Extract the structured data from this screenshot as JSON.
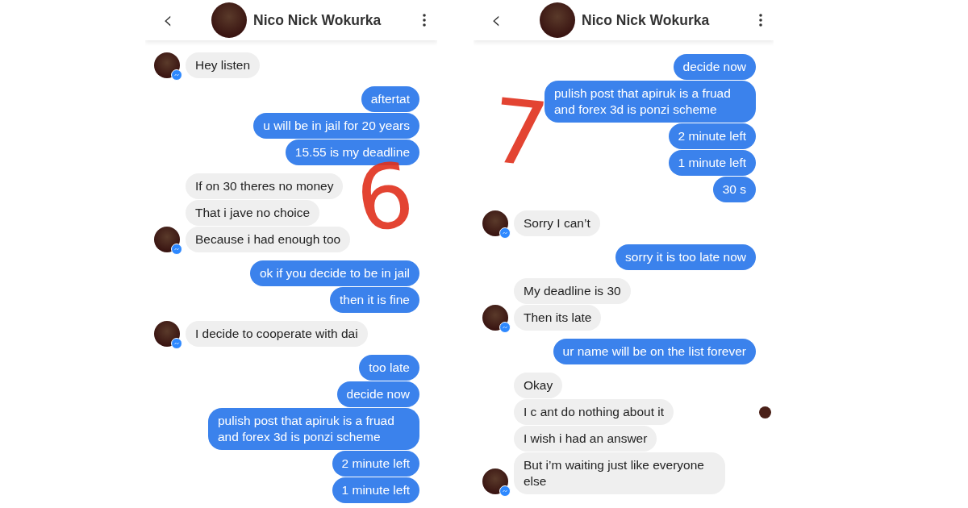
{
  "panels": [
    {
      "header": {
        "back": "‹",
        "name": "Nico Nick Wokurka"
      },
      "annotation": "6",
      "messages": [
        {
          "kind": "received",
          "text": "Hey listen"
        },
        {
          "kind": "sent",
          "text": "aftertat"
        },
        {
          "kind": "sent",
          "text": "u will be in jail for 20 years"
        },
        {
          "kind": "sent",
          "text": "15.55 is my deadline"
        },
        {
          "kind": "received",
          "text": "If on 30 theres no money"
        },
        {
          "kind": "received",
          "text": "That i jave no choice"
        },
        {
          "kind": "received",
          "text": "Because i had enough too"
        },
        {
          "kind": "sent",
          "text": "ok if you decide to be in jail"
        },
        {
          "kind": "sent",
          "text": "then it is fine"
        },
        {
          "kind": "received",
          "text": "I decide to cooperate with dai"
        },
        {
          "kind": "sent",
          "text": "too late"
        },
        {
          "kind": "sent",
          "text": "decide now"
        },
        {
          "kind": "sent",
          "text": "pulish post that apiruk is a fruad and forex 3d is ponzi scheme"
        },
        {
          "kind": "sent",
          "text": "2 minute left"
        },
        {
          "kind": "sent",
          "text": "1 minute left"
        }
      ]
    },
    {
      "header": {
        "back": "‹",
        "name": "Nico Nick Wokurka"
      },
      "annotation": "7",
      "messages": [
        {
          "kind": "sent",
          "text": "decide now"
        },
        {
          "kind": "sent",
          "text": "pulish post that apiruk is a fruad and forex 3d is ponzi scheme"
        },
        {
          "kind": "sent",
          "text": "2 minute left"
        },
        {
          "kind": "sent",
          "text": "1 minute left"
        },
        {
          "kind": "sent",
          "text": "30 s"
        },
        {
          "kind": "received",
          "text": "Sorry I can’t"
        },
        {
          "kind": "sent",
          "text": "sorry it is too late now"
        },
        {
          "kind": "received",
          "text": "My deadline is 30"
        },
        {
          "kind": "received",
          "text": "Then its late"
        },
        {
          "kind": "sent",
          "text": "ur name will be on the list forever"
        },
        {
          "kind": "received",
          "text": "Okay"
        },
        {
          "kind": "received",
          "text": "I c ant do nothing about it",
          "seen": true
        },
        {
          "kind": "received",
          "text": "I wish i had an answer"
        },
        {
          "kind": "received",
          "text": "But i’m waiting just like everyone else"
        }
      ]
    }
  ]
}
